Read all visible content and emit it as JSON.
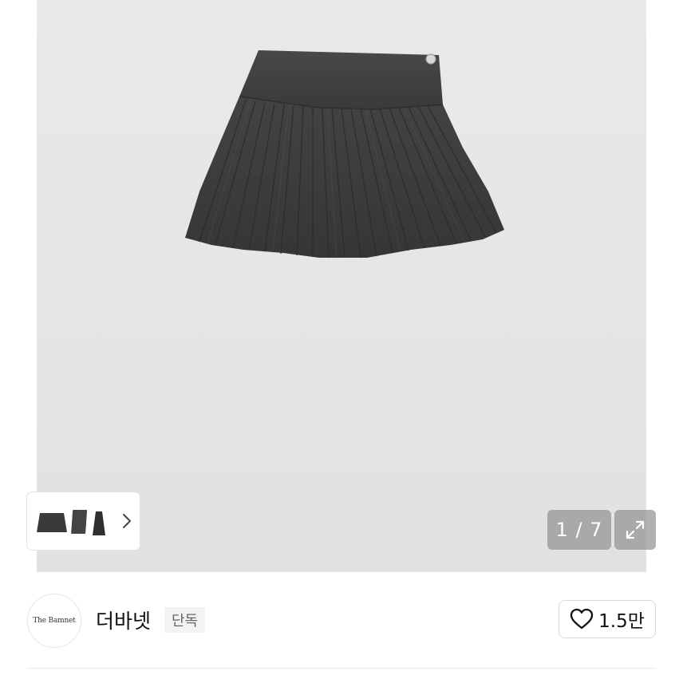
{
  "gallery": {
    "current_index": "1",
    "total": "7",
    "counter_text": "1 / 7",
    "thumbnails_icon": "chevron-right-icon",
    "expand_icon": "expand-icon"
  },
  "seller": {
    "logo_text": "The Bamnet",
    "name": "더바넷",
    "badge": "단독"
  },
  "like": {
    "icon": "heart-outline-icon",
    "count": "1.5만"
  },
  "colors": {
    "image_background": "#e6e6e6",
    "skirt": "#3f3f3f",
    "overlay_button": "#969696"
  }
}
